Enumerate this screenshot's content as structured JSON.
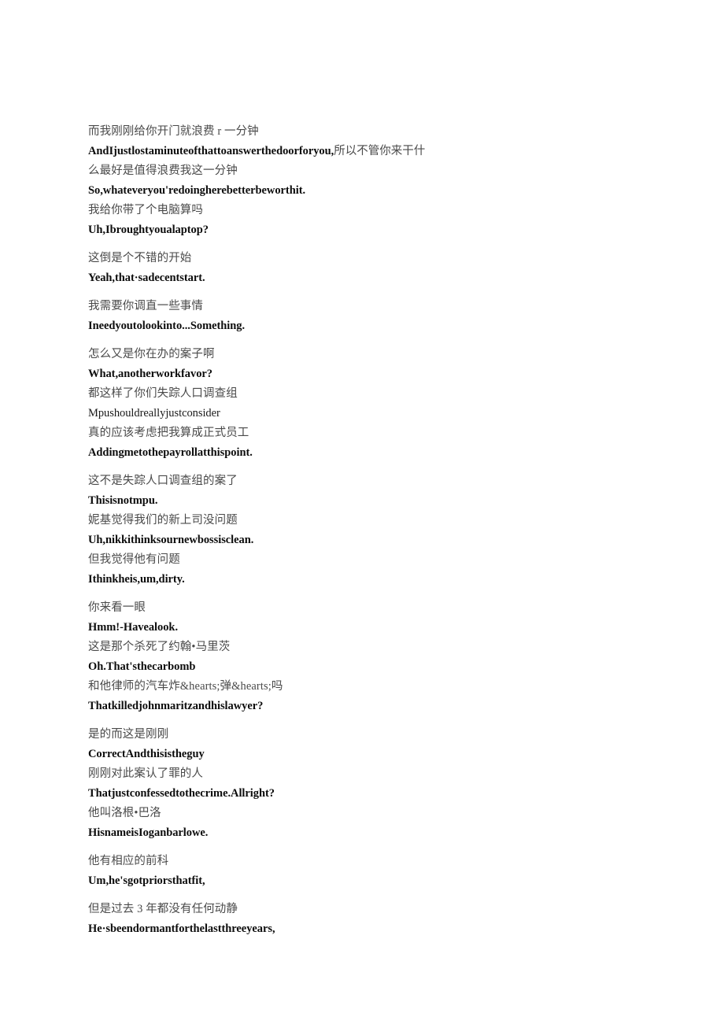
{
  "document": {
    "background_color": "#ffffff",
    "source_text_color": "#4a4a4a",
    "translit_text_color": "#0d0d0d",
    "blocks": [
      {
        "id": "block-1",
        "lines": [
          {
            "kind": "zh",
            "text": "而我刚刚给你开门就浪费 r 一分钟"
          },
          {
            "kind": "mixed",
            "en": "AndIjustlostaminuteofthattoanswerthedoorforyou,",
            "zh": "所以不管你来干什"
          },
          {
            "kind": "zh",
            "text": "么最好是值得浪费我这一分钟"
          },
          {
            "kind": "en",
            "text": "So,whateveryou'redoingherebetterbeworthit."
          },
          {
            "kind": "zh",
            "text": "我给你带了个电脑算吗"
          },
          {
            "kind": "en",
            "text": "Uh,Ibroughtyoualaptop?"
          }
        ]
      },
      {
        "id": "block-2",
        "lines": [
          {
            "kind": "zh",
            "text": "这倒是个不错的开始"
          },
          {
            "kind": "en",
            "text": "Yeah,that·sadecentstart."
          }
        ]
      },
      {
        "id": "block-3",
        "lines": [
          {
            "kind": "zh",
            "text": "我需要你调直一些事情"
          },
          {
            "kind": "en",
            "text": "Ineedyoutolookinto...Something."
          }
        ]
      },
      {
        "id": "block-4",
        "lines": [
          {
            "kind": "zh",
            "text": "怎么又是你在办的案子啊"
          },
          {
            "kind": "en",
            "text": "What,anotherworkfavor?"
          },
          {
            "kind": "zh",
            "text": "都这样了你们失踪人口调查组"
          },
          {
            "kind": "en-light",
            "text": "Mpushouldreallyjustconsider"
          },
          {
            "kind": "zh",
            "text": "真的应该考虑把我算成正式员工"
          },
          {
            "kind": "en",
            "text": "Addingmetothepayrollatthispoint."
          }
        ]
      },
      {
        "id": "block-5",
        "lines": [
          {
            "kind": "zh",
            "text": "这不是失踪人口调查组的案了"
          },
          {
            "kind": "en",
            "text": "Thisisnotmpu."
          },
          {
            "kind": "zh",
            "text": "妮基觉得我们的新上司没问题"
          },
          {
            "kind": "en",
            "text": "Uh,nikkithinksournewbossisclean."
          },
          {
            "kind": "zh",
            "text": "但我觉得他有问题"
          },
          {
            "kind": "en",
            "text": "Ithinkheis,um,dirty."
          }
        ]
      },
      {
        "id": "block-6",
        "lines": [
          {
            "kind": "zh",
            "text": "你来看一眼"
          },
          {
            "kind": "en",
            "text": "Hmm!-Havealook."
          },
          {
            "kind": "zh",
            "text": "这是那个杀死了约翰•马里茨"
          },
          {
            "kind": "en",
            "text": "Oh.That'sthecarbomb"
          },
          {
            "kind": "zh",
            "text": "和他律师的汽车炸&hearts;弹&hearts;吗"
          },
          {
            "kind": "en",
            "text": "Thatkilledjohnmaritzandhislawyer?"
          }
        ]
      },
      {
        "id": "block-7",
        "lines": [
          {
            "kind": "zh",
            "text": "是的而这是刚刚"
          },
          {
            "kind": "en",
            "text": "CorrectAndthisistheguy"
          },
          {
            "kind": "zh",
            "text": "刚刚对此案认了罪的人"
          },
          {
            "kind": "en",
            "text": "Thatjustconfessedtothecrime.Allright?"
          },
          {
            "kind": "zh",
            "text": "他叫洛根•巴洛"
          },
          {
            "kind": "en",
            "text": "HisnameisIoganbarlowe."
          }
        ]
      },
      {
        "id": "block-8",
        "lines": [
          {
            "kind": "zh",
            "text": "他有相应的前科"
          },
          {
            "kind": "en",
            "text": "Um,he'sgotpriorsthatfit,"
          }
        ]
      },
      {
        "id": "block-9",
        "lines": [
          {
            "kind": "zh",
            "text": "但是过去 3 年都没有任何动静"
          },
          {
            "kind": "en",
            "text": "He·sbeendormantforthelastthreeyears,"
          }
        ]
      }
    ]
  }
}
